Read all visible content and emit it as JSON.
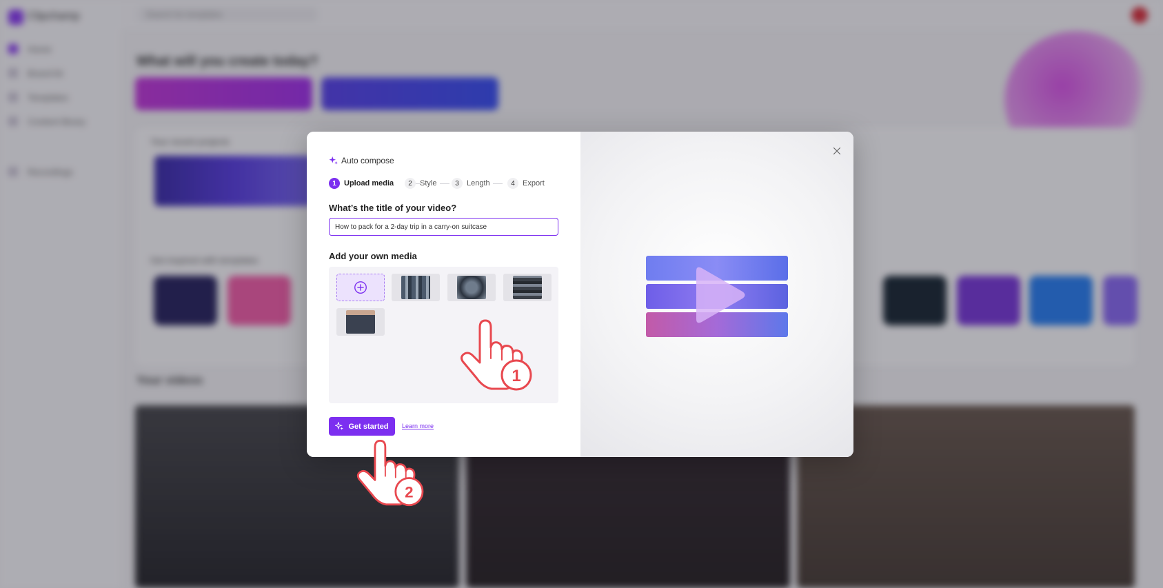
{
  "background": {
    "app_name": "Clipchamp",
    "nav": [
      "Home",
      "Brand kit",
      "Templates",
      "Content library",
      "Recordings"
    ],
    "search_placeholder": "Search for templates",
    "heading": "What will you create today?",
    "section_recent": "Your recent projects",
    "section_templates": "Get inspired with templates",
    "section_videos": "Your videos"
  },
  "modal": {
    "header": "Auto compose",
    "steps": [
      {
        "num": "1",
        "label": "Upload media",
        "active": true
      },
      {
        "num": "2",
        "label": "Style",
        "active": false
      },
      {
        "num": "3",
        "label": "Length",
        "active": false
      },
      {
        "num": "4",
        "label": "Export",
        "active": false
      }
    ],
    "title_question": "What’s the title of your video?",
    "title_value": "How to pack for a 2-day trip in a carry-on suitcase",
    "media_heading": "Add your own media",
    "media_count": 4,
    "get_started": "Get started",
    "learn_more": "Learn more"
  },
  "annotations": {
    "step1": "1",
    "step2": "2"
  },
  "colors": {
    "accent": "#7c2ff0",
    "annotation": "#e8484f"
  },
  "icons": {
    "close": "close-icon",
    "sparkle": "sparkle-icon",
    "add": "plus-circle-icon",
    "play": "play-icon"
  }
}
